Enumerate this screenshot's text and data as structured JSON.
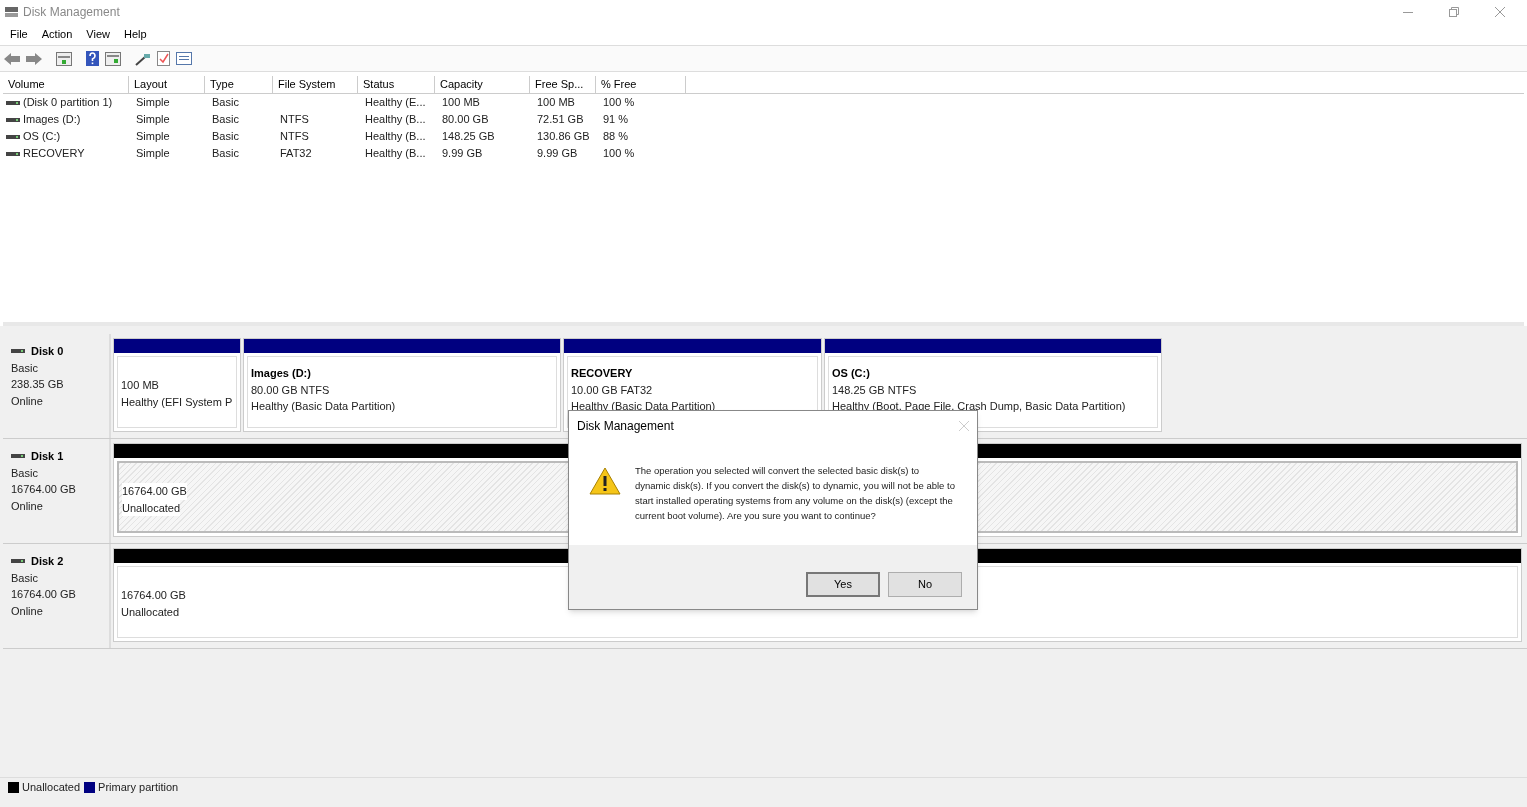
{
  "window": {
    "title": "Disk Management"
  },
  "menu": [
    "File",
    "Action",
    "View",
    "Help"
  ],
  "table": {
    "columns": [
      "Volume",
      "Layout",
      "Type",
      "File System",
      "Status",
      "Capacity",
      "Free Sp...",
      "% Free"
    ],
    "rows": [
      [
        "(Disk 0 partition 1)",
        "Simple",
        "Basic",
        "",
        "Healthy (E...",
        "100 MB",
        "100 MB",
        "100 %"
      ],
      [
        "Images (D:)",
        "Simple",
        "Basic",
        "NTFS",
        "Healthy (B...",
        "80.00 GB",
        "72.51 GB",
        "91 %"
      ],
      [
        "OS (C:)",
        "Simple",
        "Basic",
        "NTFS",
        "Healthy (B...",
        "148.25 GB",
        "130.86 GB",
        "88 %"
      ],
      [
        "RECOVERY",
        "Simple",
        "Basic",
        "FAT32",
        "Healthy (B...",
        "9.99 GB",
        "9.99 GB",
        "100 %"
      ]
    ]
  },
  "disks": [
    {
      "name": "Disk 0",
      "type": "Basic",
      "size": "238.35 GB",
      "state": "Online",
      "partitions": [
        {
          "kind": "primary",
          "selected": false,
          "size": "100 MB",
          "status": "Healthy (EFI System P"
        },
        {
          "kind": "primary",
          "selected": false,
          "title": "Images  (D:)",
          "size": "80.00 GB NTFS",
          "status": "Healthy (Basic Data Partition)"
        },
        {
          "kind": "primary",
          "selected": false,
          "title": "RECOVERY",
          "size": "10.00 GB FAT32",
          "status": "Healthy (Basic Data Partition)"
        },
        {
          "kind": "primary",
          "selected": false,
          "title": "OS  (C:)",
          "size": "148.25 GB NTFS",
          "status": "Healthy (Boot, Page File, Crash Dump, Basic Data Partition)"
        }
      ]
    },
    {
      "name": "Disk 1",
      "type": "Basic",
      "size": "16764.00 GB",
      "state": "Online",
      "partitions": [
        {
          "kind": "unallocated",
          "selected": true,
          "size": "16764.00 GB",
          "status": "Unallocated"
        }
      ]
    },
    {
      "name": "Disk 2",
      "type": "Basic",
      "size": "16764.00 GB",
      "state": "Online",
      "partitions": [
        {
          "kind": "unallocated",
          "selected": false,
          "size": "16764.00 GB",
          "status": "Unallocated"
        }
      ]
    }
  ],
  "legend": [
    {
      "label": "Unallocated",
      "color": "#000000"
    },
    {
      "label": "Primary partition",
      "color": "#000080"
    }
  ],
  "dialog": {
    "title": "Disk Management",
    "message": "The operation you selected will convert the selected basic disk(s) to dynamic disk(s). If you convert the disk(s) to dynamic, you will not be able to start installed operating systems from any volume on the disk(s) (except the current boot volume). Are you sure you want to continue?",
    "buttons": [
      "Yes",
      "No"
    ]
  }
}
